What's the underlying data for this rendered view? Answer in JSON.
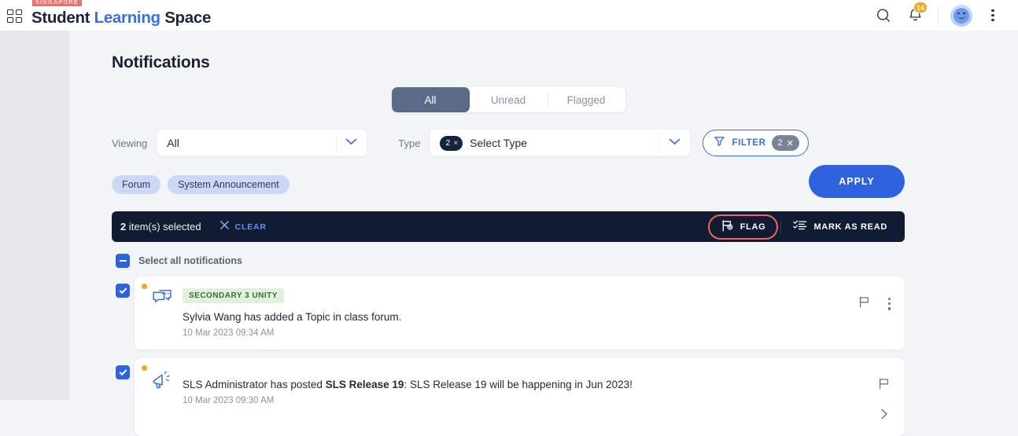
{
  "brand": {
    "badge": "SINGAPORE",
    "word1": "Student",
    "word2": "Learning",
    "word3": "Space",
    "grid_icon": "grid-apps-icon"
  },
  "topbar": {
    "search_icon": "search-icon",
    "bell_icon": "notification-bell-icon",
    "bell_badge": "14",
    "avatar_icon": "user-avatar",
    "menu_icon": "kebab-menu-icon"
  },
  "page": {
    "title": "Notifications"
  },
  "tabs": [
    {
      "label": "All",
      "active": true
    },
    {
      "label": "Unread",
      "active": false
    },
    {
      "label": "Flagged",
      "active": false
    }
  ],
  "filters": {
    "viewing_label": "Viewing",
    "viewing_value": "All",
    "type_label": "Type",
    "type_value": "Select Type",
    "type_count": "2",
    "type_clear": "×",
    "filter_button": "FILTER",
    "filter_count": "2",
    "filter_clear": "✕",
    "filter_icon": "funnel-icon",
    "chevron_icon": "chevron-down-icon"
  },
  "chips": [
    {
      "label": "Forum"
    },
    {
      "label": "System Announcement"
    }
  ],
  "apply_button": "APPLY",
  "actionbar": {
    "selected_count": "2",
    "selected_text": " item(s) selected",
    "clear_label": "CLEAR",
    "clear_icon": "close-x-icon",
    "flag_label": "FLAG",
    "flag_icon": "flag-add-icon",
    "mark_read_label": "MARK AS READ",
    "mark_read_icon": "mark-as-read-icon",
    "highlight_color": "#f0655e"
  },
  "select_all": {
    "label": "Select all notifications",
    "state": "indeterminate"
  },
  "notifications": [
    {
      "checked": true,
      "unread": true,
      "icon": "forum-chat-icon",
      "badge": "SECONDARY 3 UNITY",
      "text_before": "Sylvia Wang has added a Topic in class forum.",
      "text_bold": "",
      "text_after": "",
      "time": "10 Mar 2023 09:34 AM",
      "flag_icon": "flag-outline-icon",
      "more_icon": "kebab-menu-icon"
    },
    {
      "checked": true,
      "unread": true,
      "icon": "megaphone-announcement-icon",
      "badge": "",
      "text_before": "SLS Administrator has posted ",
      "text_bold": "SLS Release 19",
      "text_after": ": SLS Release 19 will be happening in Jun 2023!",
      "time": "10 Mar 2023 09:30 AM",
      "flag_icon": "flag-outline-icon",
      "more_icon": "chevron-right-icon"
    }
  ],
  "colors": {
    "accent_blue": "#2f63de",
    "dark_bar": "#111c33",
    "badge_orange": "#f5a623",
    "brand_red": "#ef6f6c"
  }
}
